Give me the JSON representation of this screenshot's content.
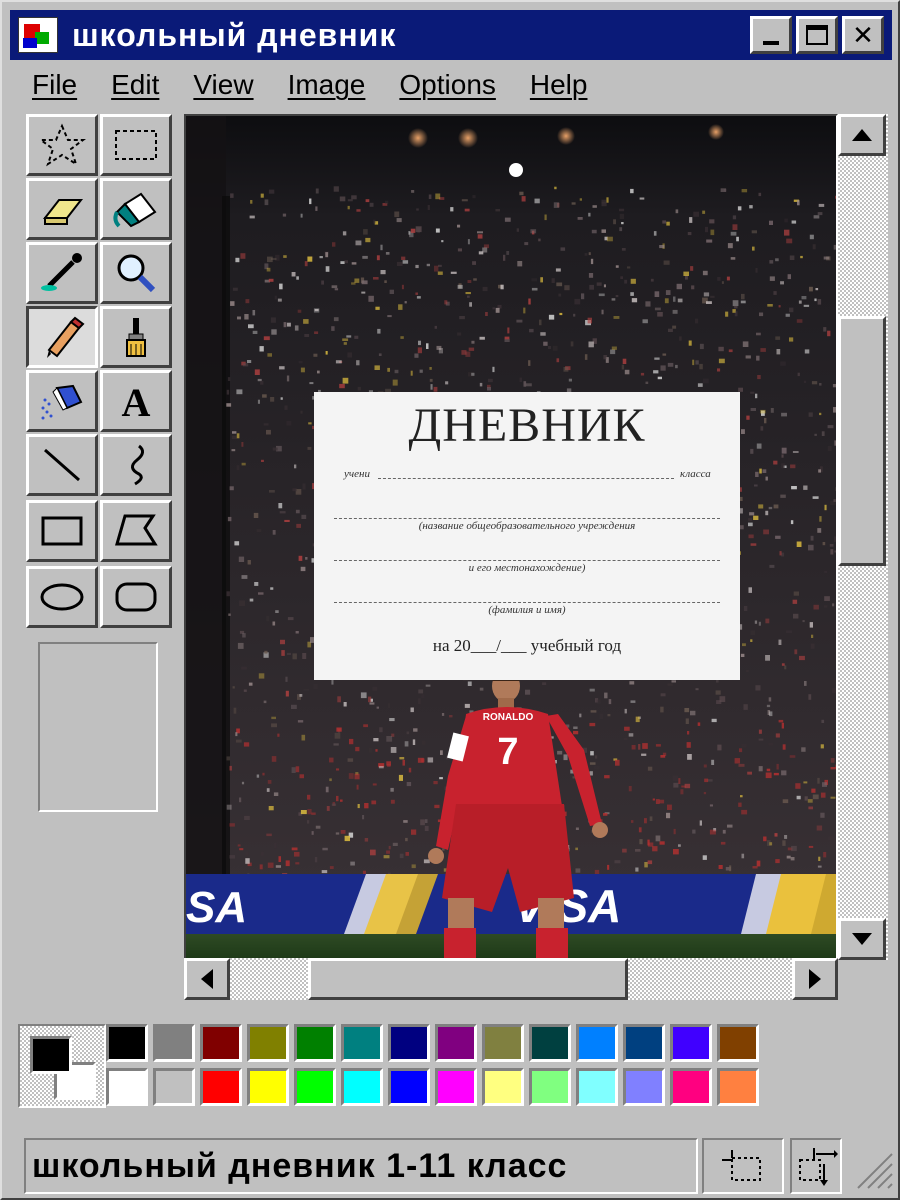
{
  "window": {
    "title": "школьный дневник",
    "minimize_icon": "minimize-icon",
    "maximize_icon": "maximize-icon",
    "close_label": "✕"
  },
  "menu": [
    {
      "label": "File"
    },
    {
      "label": "Edit"
    },
    {
      "label": "View"
    },
    {
      "label": "Image"
    },
    {
      "label": "Options"
    },
    {
      "label": "Help"
    }
  ],
  "tools": [
    {
      "name": "free-form-select",
      "icon": "star-select-icon"
    },
    {
      "name": "select",
      "icon": "rect-select-icon"
    },
    {
      "name": "eraser",
      "icon": "eraser-icon"
    },
    {
      "name": "fill",
      "icon": "paint-bucket-icon"
    },
    {
      "name": "pick-color",
      "icon": "eyedropper-icon"
    },
    {
      "name": "magnifier",
      "icon": "magnifier-icon"
    },
    {
      "name": "pencil",
      "icon": "pencil-icon",
      "active": true
    },
    {
      "name": "brush",
      "icon": "brush-icon"
    },
    {
      "name": "airbrush",
      "icon": "airbrush-icon"
    },
    {
      "name": "text",
      "icon": "text-icon"
    },
    {
      "name": "line",
      "icon": "line-icon"
    },
    {
      "name": "curve",
      "icon": "curve-icon"
    },
    {
      "name": "rectangle",
      "icon": "rectangle-icon"
    },
    {
      "name": "polygon",
      "icon": "polygon-icon"
    },
    {
      "name": "ellipse",
      "icon": "ellipse-icon"
    },
    {
      "name": "rounded-rectangle",
      "icon": "rounded-rect-icon"
    }
  ],
  "document": {
    "title": "ДНЕВНИК",
    "student_prefix": "учени",
    "class_suffix": "класса",
    "caption_school": "(название общеобразовательного учреждения",
    "caption_location": "и его местонахождение)",
    "caption_name": "(фамилия и имя)",
    "year_line": "на 20___/___ учебный год"
  },
  "jersey": {
    "name": "RONALDO",
    "number": "7"
  },
  "banner": {
    "text": "VISA"
  },
  "colors": {
    "foreground": "#000000",
    "background": "#ffffff",
    "row1": [
      "#000000",
      "#808080",
      "#800000",
      "#808000",
      "#008000",
      "#008080",
      "#000080",
      "#800080",
      "#808040",
      "#004040",
      "#0080ff",
      "#004080",
      "#4000ff",
      "#804000"
    ],
    "row2": [
      "#ffffff",
      "#c0c0c0",
      "#ff0000",
      "#ffff00",
      "#00ff00",
      "#00ffff",
      "#0000ff",
      "#ff00ff",
      "#ffff80",
      "#80ff80",
      "#80ffff",
      "#8080ff",
      "#ff0080",
      "#ff8040"
    ]
  },
  "status": {
    "text": "школьный дневник 1-11 класс"
  }
}
